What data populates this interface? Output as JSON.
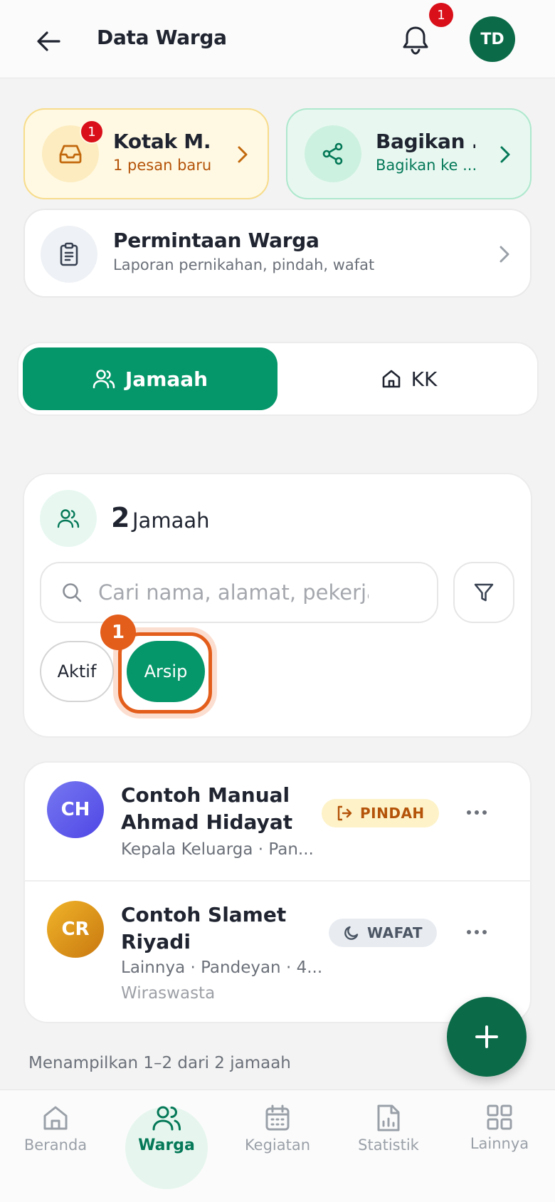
{
  "header": {
    "title": "Data Warga",
    "notification_count": "1",
    "avatar_initials": "TD"
  },
  "inbox_card": {
    "title": "Kotak M...",
    "subtitle": "1 pesan baru",
    "badge": "1"
  },
  "share_card": {
    "title": "Bagikan ...",
    "subtitle": "Bagikan ke ..."
  },
  "request_card": {
    "title": "Permintaan Warga",
    "subtitle": "Laporan pernikahan, pindah, wafat"
  },
  "tabs": {
    "jamaah": "Jamaah",
    "kk": "KK",
    "active": "Jamaah"
  },
  "summary": {
    "count": "2",
    "label": "Jamaah"
  },
  "search": {
    "placeholder": "Cari nama, alamat, pekerjaan",
    "value": ""
  },
  "filters": {
    "aktif": "Aktif",
    "arsip": "Arsip",
    "selected": "Arsip",
    "step_badge": "1"
  },
  "residents": [
    {
      "initials": "CH",
      "name": "Contoh Manual Ahmad Hidayat",
      "meta": "Kepala Keluarga · Pan...",
      "status": "PINDAH",
      "avatar_color": "#6366f1"
    },
    {
      "initials": "CR",
      "name": "Contoh Slamet Riyadi",
      "meta": "Lainnya · Pandeyan · 4...",
      "meta2": "Wiraswasta",
      "status": "WAFAT",
      "avatar_color": "#e3a11c"
    }
  ],
  "footer": {
    "showing": "Menampilkan 1–2 dari 2 jamaah"
  },
  "bottom_nav": [
    {
      "label": "Beranda",
      "icon": "home-icon"
    },
    {
      "label": "Warga",
      "icon": "users-icon",
      "active": true
    },
    {
      "label": "Kegiatan",
      "icon": "calendar-icon"
    },
    {
      "label": "Statistik",
      "icon": "chart-file-icon"
    },
    {
      "label": "Lainnya",
      "icon": "grid-icon"
    }
  ],
  "colors": {
    "primary": "#059669",
    "primary_dark": "#0b6b48",
    "highlight": "#e35d1b",
    "badge_red": "#d90f1a"
  }
}
